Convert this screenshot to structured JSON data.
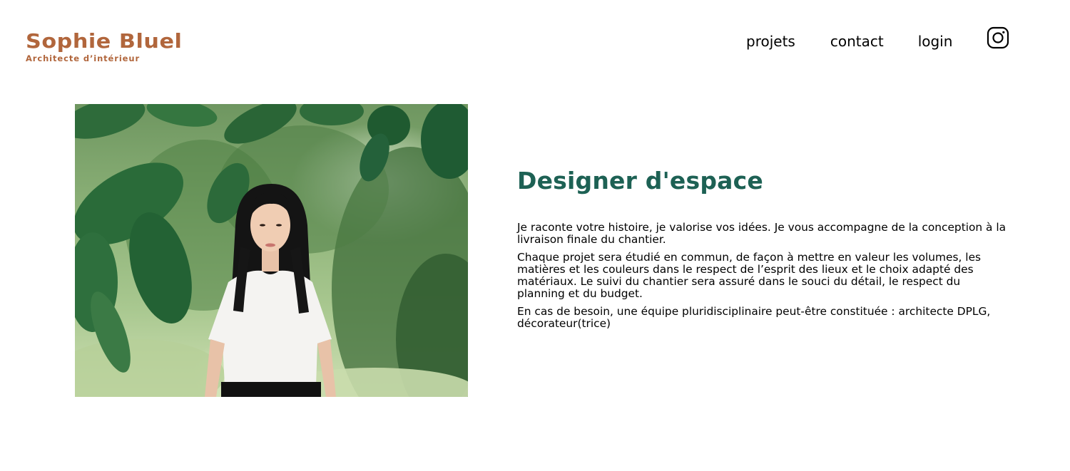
{
  "header": {
    "brand_name": "Sophie Bluel",
    "brand_subtitle": "Architecte d’intérieur",
    "nav": {
      "projets": "projets",
      "contact": "contact",
      "login": "login"
    },
    "social_icon": "instagram-icon"
  },
  "introduction": {
    "photo_icon": "portrait-photo",
    "title": "Designer d'espace",
    "paragraphs": [
      "Je raconte votre histoire, je valorise vos idées. Je vous accompagne de la conception à la livraison finale du chantier.",
      "Chaque projet sera étudié en commun, de façon à mettre en valeur les volumes, les matières et les couleurs dans le respect de l’esprit des lieux et le choix adapté des matériaux. Le suivi du chantier sera assuré dans le souci du détail, le respect du planning et du budget.",
      "En cas de besoin, une équipe pluridisciplinaire peut-être constituée : architecte DPLG, décorateur(trice)"
    ]
  },
  "colors": {
    "brand": "#B1663C",
    "title": "#1D6154",
    "text": "#000000",
    "background": "#FFFFFF"
  }
}
